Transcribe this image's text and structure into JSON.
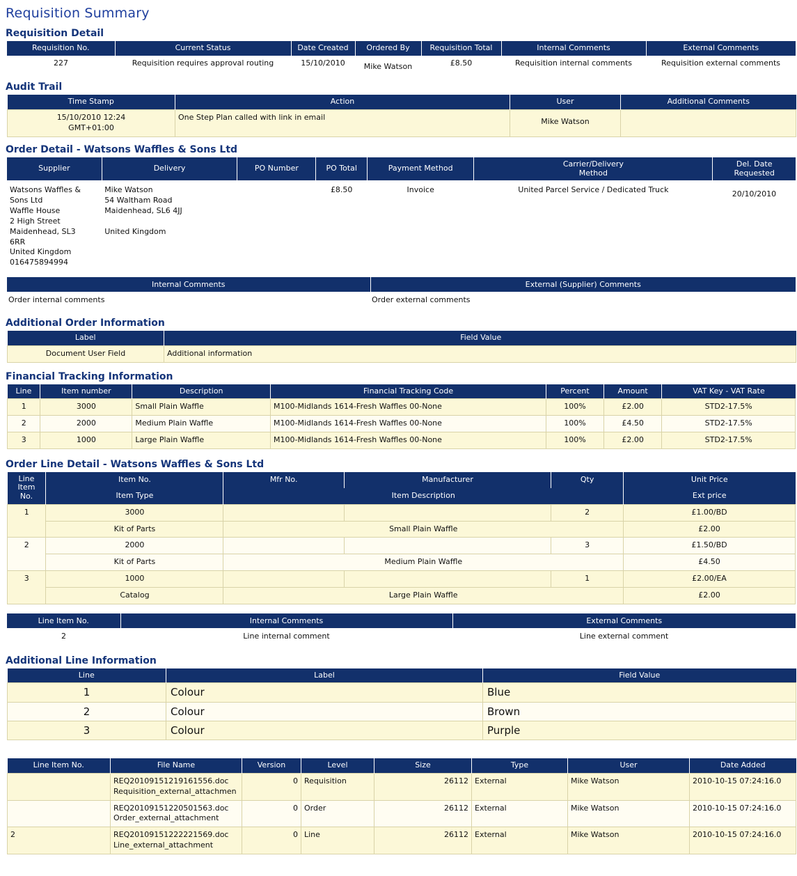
{
  "page_title": "Requisition Summary",
  "sections": {
    "requisition_detail": {
      "title": "Requisition Detail",
      "headers": [
        "Requisition No.",
        "Current Status",
        "Date Created",
        "Ordered By",
        "Requisition Total",
        "Internal Comments",
        "External Comments"
      ],
      "row": {
        "requisition_no": "227",
        "current_status": "Requisition requires approval routing",
        "date_created": "15/10/2010",
        "ordered_by": "Mike Watson",
        "requisition_total": "£8.50",
        "internal_comments": "Requisition internal comments",
        "external_comments": "Requisition external comments"
      }
    },
    "audit_trail": {
      "title": "Audit Trail",
      "headers": [
        "Time Stamp",
        "Action",
        "User",
        "Additional Comments"
      ],
      "rows": [
        {
          "time_stamp": "15/10/2010 12:24\nGMT+01:00",
          "action": "One Step Plan called with link in email",
          "user": "Mike Watson",
          "additional_comments": ""
        }
      ]
    },
    "order_detail": {
      "title": "Order Detail - Watsons Waffles & Sons Ltd",
      "headers": [
        "Supplier",
        "Delivery",
        "PO Number",
        "PO Total",
        "Payment Method",
        "Carrier/Delivery\nMethod",
        "Del. Date\nRequested"
      ],
      "row": {
        "supplier": "Watsons Waffles &\nSons Ltd\nWaffle House\n2 High Street\nMaidenhead,    SL3\n6RR\nUnited Kingdom\n016475894994",
        "delivery": "Mike Watson\n54 Waltham Road\nMaidenhead,    SL6 4JJ\n\nUnited Kingdom",
        "po_number": "",
        "po_total": "£8.50",
        "payment_method": "Invoice",
        "carrier_delivery_method": "United Parcel Service / Dedicated Truck",
        "del_date_requested": "20/10/2010"
      },
      "comments_headers": [
        "Internal Comments",
        "External (Supplier) Comments"
      ],
      "comments_row": {
        "internal": "Order internal comments",
        "external": "Order external comments"
      }
    },
    "additional_order_information": {
      "title": "Additional Order Information",
      "headers": [
        "Label",
        "Field Value"
      ],
      "rows": [
        {
          "label": "Document User Field",
          "field_value": "Additional information"
        }
      ]
    },
    "financial_tracking": {
      "title": "Financial Tracking Information",
      "headers": [
        "Line",
        "Item number",
        "Description",
        "Financial Tracking Code",
        "Percent",
        "Amount",
        "VAT Key - VAT Rate"
      ],
      "rows": [
        {
          "line": "1",
          "item_number": "3000",
          "description": "Small Plain Waffle",
          "code": "M100-Midlands 1614-Fresh Waffles 00-None",
          "percent": "100%",
          "amount": "£2.00",
          "vat": "STD2-17.5%"
        },
        {
          "line": "2",
          "item_number": "2000",
          "description": "Medium Plain Waffle",
          "code": "M100-Midlands 1614-Fresh Waffles 00-None",
          "percent": "100%",
          "amount": "£4.50",
          "vat": "STD2-17.5%"
        },
        {
          "line": "3",
          "item_number": "1000",
          "description": "Large Plain Waffle",
          "code": "M100-Midlands 1614-Fresh Waffles 00-None",
          "percent": "100%",
          "amount": "£2.00",
          "vat": "STD2-17.5%"
        }
      ]
    },
    "order_line_detail": {
      "title": "Order Line Detail - Watsons Waffles & Sons Ltd",
      "headers_row1": [
        "Line\nItem\nNo.",
        "Item No.",
        "Mfr No.",
        "Manufacturer",
        "Qty",
        "Unit Price"
      ],
      "headers_row2": [
        "Item Type",
        "Item Description",
        "Ext price"
      ],
      "rows": [
        {
          "line_item_no": "1",
          "item_no": "3000",
          "mfr_no": "",
          "manufacturer": "",
          "qty": "2",
          "unit_price": "£1.00/BD",
          "item_type": "Kit of Parts",
          "item_description": "Small Plain Waffle",
          "ext_price": "£2.00"
        },
        {
          "line_item_no": "2",
          "item_no": "2000",
          "mfr_no": "",
          "manufacturer": "",
          "qty": "3",
          "unit_price": "£1.50/BD",
          "item_type": "Kit of Parts",
          "item_description": "Medium Plain Waffle",
          "ext_price": "£4.50"
        },
        {
          "line_item_no": "3",
          "item_no": "1000",
          "mfr_no": "",
          "manufacturer": "",
          "qty": "1",
          "unit_price": "£2.00/EA",
          "item_type": "Catalog",
          "item_description": "Large Plain Waffle",
          "ext_price": "£2.00"
        }
      ],
      "comments_headers": [
        "Line Item No.",
        "Internal Comments",
        "External Comments"
      ],
      "comments_row": {
        "line_item_no": "2",
        "internal": "Line internal comment",
        "external": "Line external comment"
      }
    },
    "additional_line_information": {
      "title": "Additional Line Information",
      "headers": [
        "Line",
        "Label",
        "Field Value"
      ],
      "rows": [
        {
          "line": "1",
          "label": "Colour",
          "field_value": "Blue"
        },
        {
          "line": "2",
          "label": "Colour",
          "field_value": "Brown"
        },
        {
          "line": "3",
          "label": "Colour",
          "field_value": "Purple"
        }
      ]
    },
    "attachments": {
      "headers": [
        "Line Item No.",
        "File Name",
        "Version",
        "Level",
        "Size",
        "Type",
        "User",
        "Date Added"
      ],
      "rows": [
        {
          "line_item_no": "",
          "file_name": "REQ20109151219161556.doc\nRequisition_external_attachmen",
          "version": "0",
          "level": "Requisition",
          "size": "26112",
          "type": "External",
          "user": "Mike Watson",
          "date_added": "2010-10-15 07:24:16.0"
        },
        {
          "line_item_no": "",
          "file_name": "REQ20109151220501563.doc\nOrder_external_attachment",
          "version": "0",
          "level": "Order",
          "size": "26112",
          "type": "External",
          "user": "Mike Watson",
          "date_added": "2010-10-15 07:24:16.0"
        },
        {
          "line_item_no": "2",
          "file_name": "REQ20109151222221569.doc\nLine_external_attachment",
          "version": "0",
          "level": "Line",
          "size": "26112",
          "type": "External",
          "user": "Mike Watson",
          "date_added": "2010-10-15 07:24:16.0"
        }
      ]
    }
  },
  "colors": {
    "header_blue": "#12306b",
    "title_blue": "#1f3f9e",
    "section_blue": "#15357a",
    "row_yellow": "#fcf8d8",
    "row_white": "#fffdf2",
    "cell_border": "#d9d3a8"
  }
}
